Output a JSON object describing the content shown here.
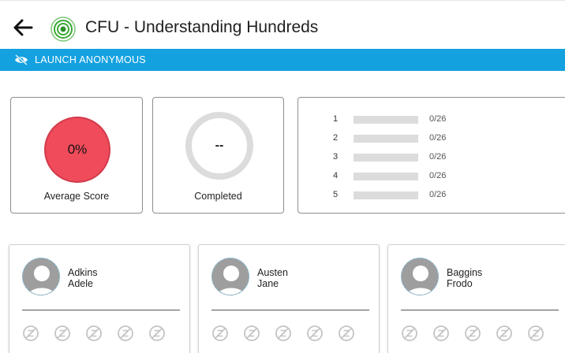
{
  "header": {
    "title": "CFU - Understanding Hundreds"
  },
  "anonymous_bar": {
    "label": "LAUNCH ANONYMOUS"
  },
  "summary": {
    "average_score": {
      "value": "0%",
      "label": "Average Score"
    },
    "completed": {
      "value": "--",
      "label": "Completed"
    }
  },
  "questions": [
    {
      "number": "1",
      "count": "0/26",
      "fraction": 0
    },
    {
      "number": "2",
      "count": "0/26",
      "fraction": 0
    },
    {
      "number": "3",
      "count": "0/26",
      "fraction": 0
    },
    {
      "number": "4",
      "count": "0/26",
      "fraction": 0
    },
    {
      "number": "5",
      "count": "0/26",
      "fraction": 0
    }
  ],
  "students": [
    {
      "last_name": "Adkins",
      "first_name": "Adele"
    },
    {
      "last_name": "Austen",
      "first_name": "Jane"
    },
    {
      "last_name": "Baggins",
      "first_name": "Frodo"
    }
  ],
  "colors": {
    "accent": "#14a1e0",
    "score_red": "#f04b5b",
    "brand_green": "#3aa935"
  },
  "icons": {
    "back": "arrow-left-icon",
    "app": "target-icon",
    "anonymous": "eye-off-icon",
    "avatar": "person-silhouette-icon",
    "question_status": "not-answered-icon"
  }
}
